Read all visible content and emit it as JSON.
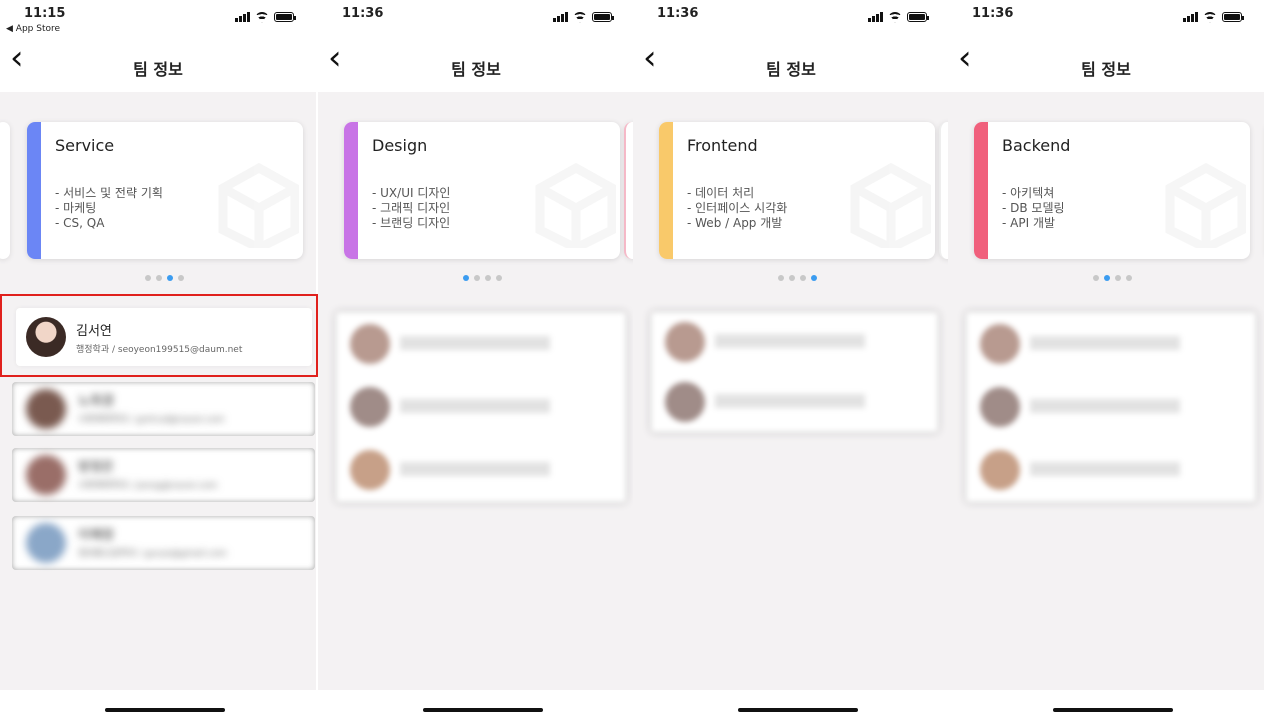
{
  "nav_title": "팀 정보",
  "screens": [
    {
      "time": "11:15",
      "back_app": "◀ App Store"
    },
    {
      "time": "11:36"
    },
    {
      "time": "11:36"
    },
    {
      "time": "11:36"
    }
  ],
  "cards": [
    {
      "name": "Service",
      "desc": "- 서비스 및 전략 기획\n- 마케팅\n- CS, QA",
      "color": "#6b86f5",
      "active_dot": 2
    },
    {
      "name": "Design",
      "desc": "- UX/UI 디자인\n- 그래픽 디자인\n- 브랜딩 디자인",
      "color": "#c874e6",
      "active_dot": 0
    },
    {
      "name": "Frontend",
      "desc": "- 데이터 처리\n- 인터페이스 시각화\n- Web / App 개발",
      "color": "#f9c96a",
      "active_dot": 3
    },
    {
      "name": "Backend",
      "desc": "- 아키텍쳐\n- DB 모델링\n- API 개발",
      "color": "#f0607c",
      "active_dot": 1
    }
  ],
  "members": [
    {
      "name": "김서연",
      "sub": "행정학과 / seoyeon199515@daum.net"
    },
    {
      "name": "노희경",
      "sub": "사회체육학과 / gmlrud@naver.com"
    },
    {
      "name": "방정은",
      "sub": "사회체육학과 / jeong@naver.com"
    },
    {
      "name": "이혜정",
      "sub": "정보통신공학과 / gurye@gmail.com"
    }
  ],
  "colors": {
    "highlight": "#e0201c",
    "dot_active": "#3b9cf0",
    "background": "#f4f2f3"
  }
}
